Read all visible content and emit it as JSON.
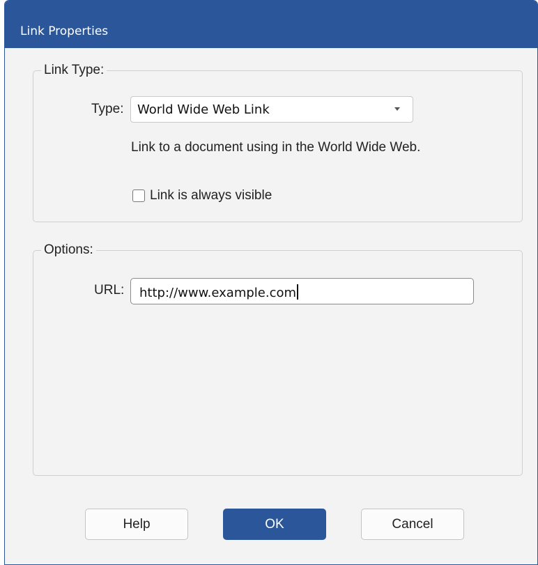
{
  "window": {
    "title": "Link Properties"
  },
  "link_type_group": {
    "label": "Link Type:",
    "type_label": "Type:",
    "type_select_value": "World Wide Web Link",
    "description": "Link to a document using in the World Wide Web.",
    "visible_checkbox_label": "Link is always visible",
    "visible_checked": false
  },
  "options_group": {
    "label": "Options:",
    "url_label": "URL:",
    "url_value": "http://www.example.com"
  },
  "buttons": {
    "help": "Help",
    "ok": "OK",
    "cancel": "Cancel"
  },
  "colors": {
    "accent": "#2b579a",
    "dialog_bg": "#f3f3f3"
  }
}
